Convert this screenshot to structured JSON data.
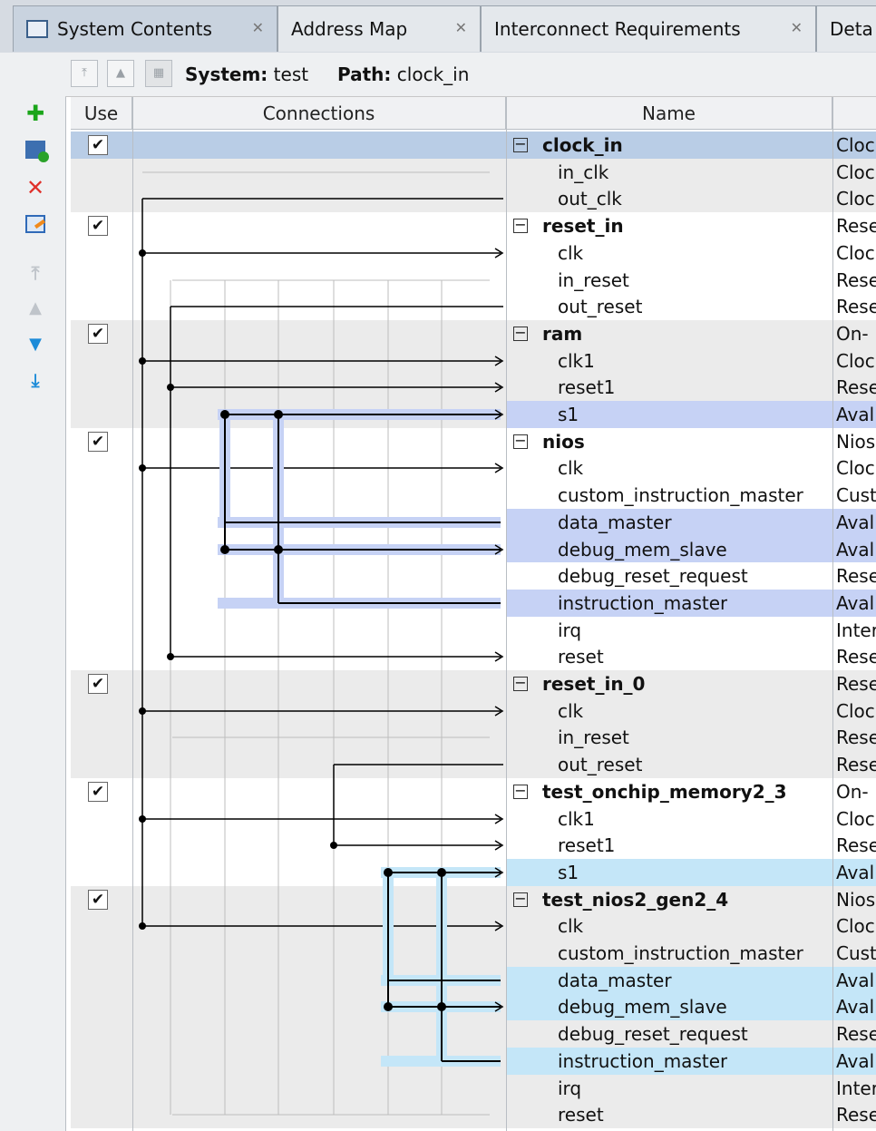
{
  "tabs": [
    {
      "label": "System Contents",
      "active": true
    },
    {
      "label": "Address Map",
      "active": false
    },
    {
      "label": "Interconnect Requirements",
      "active": false
    },
    {
      "label": "Deta",
      "active": false
    }
  ],
  "toolbar": {
    "system_label": "System:",
    "system_value": "test",
    "path_label": "Path:",
    "path_value": "clock_in"
  },
  "columns": {
    "use": "Use",
    "connections": "Connections",
    "name": "Name"
  },
  "rows": [
    {
      "name": "clock_in",
      "kind": "comp",
      "desc": "Cloc",
      "checked": true
    },
    {
      "name": "in_clk",
      "kind": "port",
      "desc": "Cloc"
    },
    {
      "name": "out_clk",
      "kind": "port",
      "desc": "Cloc"
    },
    {
      "name": "reset_in",
      "kind": "comp",
      "desc": "Rese",
      "checked": true
    },
    {
      "name": "clk",
      "kind": "port",
      "desc": "Cloc"
    },
    {
      "name": "in_reset",
      "kind": "port",
      "desc": "Rese"
    },
    {
      "name": "out_reset",
      "kind": "port",
      "desc": "Rese"
    },
    {
      "name": "ram",
      "kind": "comp",
      "desc": "On-",
      "checked": true
    },
    {
      "name": "clk1",
      "kind": "port",
      "desc": "Cloc"
    },
    {
      "name": "reset1",
      "kind": "port",
      "desc": "Rese"
    },
    {
      "name": "s1",
      "kind": "port",
      "desc": "Aval",
      "hl": "blue"
    },
    {
      "name": "nios",
      "kind": "comp",
      "desc": "Nios",
      "checked": true
    },
    {
      "name": "clk",
      "kind": "port",
      "desc": "Cloc"
    },
    {
      "name": "custom_instruction_master",
      "kind": "port",
      "desc": "Cust"
    },
    {
      "name": "data_master",
      "kind": "port",
      "desc": "Aval",
      "hl": "blue"
    },
    {
      "name": "debug_mem_slave",
      "kind": "port",
      "desc": "Aval",
      "hl": "blue"
    },
    {
      "name": "debug_reset_request",
      "kind": "port",
      "desc": "Rese"
    },
    {
      "name": "instruction_master",
      "kind": "port",
      "desc": "Aval",
      "hl": "blue"
    },
    {
      "name": "irq",
      "kind": "port",
      "desc": "Inter"
    },
    {
      "name": "reset",
      "kind": "port",
      "desc": "Rese"
    },
    {
      "name": "reset_in_0",
      "kind": "comp",
      "desc": "Rese",
      "checked": true
    },
    {
      "name": "clk",
      "kind": "port",
      "desc": "Cloc"
    },
    {
      "name": "in_reset",
      "kind": "port",
      "desc": "Rese"
    },
    {
      "name": "out_reset",
      "kind": "port",
      "desc": "Rese"
    },
    {
      "name": "test_onchip_memory2_3",
      "kind": "comp",
      "desc": "On-",
      "checked": true
    },
    {
      "name": "clk1",
      "kind": "port",
      "desc": "Cloc"
    },
    {
      "name": "reset1",
      "kind": "port",
      "desc": "Rese"
    },
    {
      "name": "s1",
      "kind": "port",
      "desc": "Aval",
      "hl": "cyan"
    },
    {
      "name": "test_nios2_gen2_4",
      "kind": "comp",
      "desc": "Nios",
      "checked": true
    },
    {
      "name": "clk",
      "kind": "port",
      "desc": "Cloc"
    },
    {
      "name": "custom_instruction_master",
      "kind": "port",
      "desc": "Cust"
    },
    {
      "name": "data_master",
      "kind": "port",
      "desc": "Aval",
      "hl": "cyan"
    },
    {
      "name": "debug_mem_slave",
      "kind": "port",
      "desc": "Aval",
      "hl": "cyan"
    },
    {
      "name": "debug_reset_request",
      "kind": "port",
      "desc": "Rese"
    },
    {
      "name": "instruction_master",
      "kind": "port",
      "desc": "Aval",
      "hl": "cyan"
    },
    {
      "name": "irq",
      "kind": "port",
      "desc": "Inter"
    },
    {
      "name": "reset",
      "kind": "port",
      "desc": "Rese"
    }
  ],
  "colors": {
    "blue_highlight": "#c6d2f5",
    "cyan_highlight": "#c4e6f8",
    "selected_row": "#b9cde6",
    "alt_row": "#ebebeb",
    "active_wire": "#000000",
    "inactive_wire": "#bdbdbd"
  }
}
